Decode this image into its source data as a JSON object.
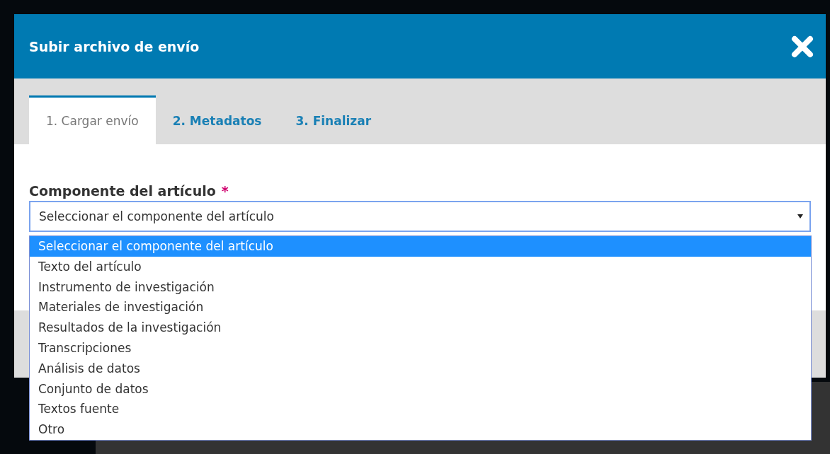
{
  "modal": {
    "title": "Subir archivo de envío"
  },
  "tabs": [
    {
      "label": "1. Cargar envío",
      "selected": true
    },
    {
      "label": "2. Metadatos",
      "selected": false
    },
    {
      "label": "3. Finalizar",
      "selected": false
    }
  ],
  "field": {
    "label": "Componente del artículo",
    "required_mark": "*",
    "value": "Seleccionar el componente del artículo",
    "expanded": true
  },
  "options": [
    {
      "label": "Seleccionar el componente del artículo",
      "selected": true
    },
    {
      "label": "Texto del artículo",
      "selected": false
    },
    {
      "label": "Instrumento de investigación",
      "selected": false
    },
    {
      "label": "Materiales de investigación",
      "selected": false
    },
    {
      "label": "Resultados de la investigación",
      "selected": false
    },
    {
      "label": "Transcripciones",
      "selected": false
    },
    {
      "label": "Análisis de datos",
      "selected": false
    },
    {
      "label": "Conjunto de datos",
      "selected": false
    },
    {
      "label": "Textos fuente",
      "selected": false
    },
    {
      "label": "Otro",
      "selected": false
    }
  ]
}
